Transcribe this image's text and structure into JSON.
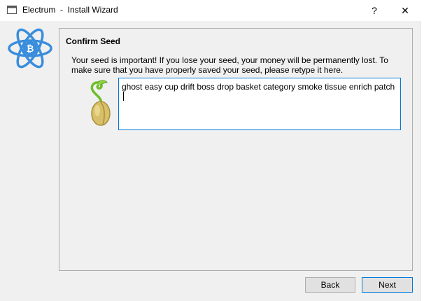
{
  "window": {
    "title": "Electrum  -  Install Wizard",
    "help_label": "?",
    "close_label": "✕"
  },
  "panel": {
    "title": "Confirm Seed",
    "message": "Your seed is important! If you lose your seed, your money will be permanently lost. To make sure that you have properly saved your seed, please retype it here.",
    "seed_value": "ghost easy cup drift boss drop basket category smoke tissue enrich patch "
  },
  "buttons": {
    "back_label": "Back",
    "next_label": "Next"
  },
  "colors": {
    "accent": "#0078d7",
    "logo": "#3a8ddc"
  }
}
